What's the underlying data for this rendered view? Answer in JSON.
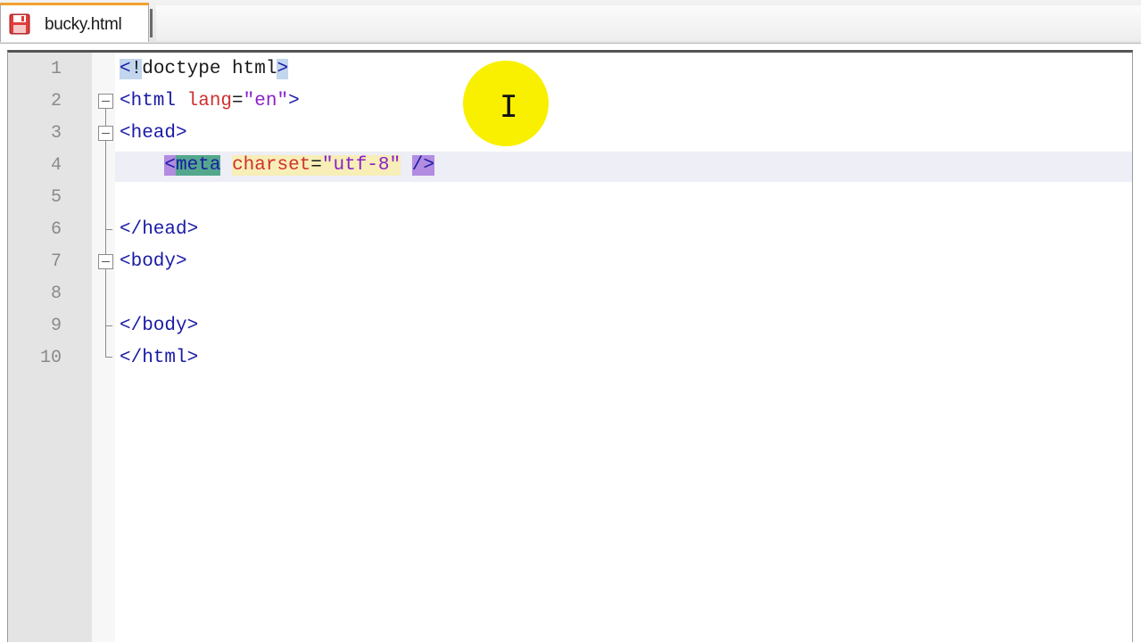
{
  "tab": {
    "filename": "bucky.html",
    "icon": "save-disk-icon"
  },
  "editor": {
    "line_numbers": [
      "1",
      "2",
      "3",
      "4",
      "5",
      "6",
      "7",
      "8",
      "9",
      "10"
    ],
    "current_line": 4,
    "cursor_icon": "text-cursor-icon",
    "lines": {
      "l1": {
        "open": "<",
        "bang": "!",
        "doctype": "doctype html",
        "close": ">"
      },
      "l2": {
        "tag": "<html",
        "attr": "lang",
        "eq": "=",
        "val": "\"en\"",
        "close": ">"
      },
      "l3": {
        "tag": "<head>"
      },
      "l4": {
        "lt": "<",
        "name": "meta",
        "attr": "charset",
        "eq": "=",
        "val": "\"utf-8\"",
        "end": "/>"
      },
      "l6": {
        "tag": "</head>"
      },
      "l7": {
        "tag": "<body>"
      },
      "l9": {
        "tag": "</body>"
      },
      "l10": {
        "tag": "</html>"
      }
    }
  },
  "colors": {
    "tag": "#1a1aa6",
    "attribute": "#d03030",
    "string": "#8a20c8",
    "gutter_bg": "#e4e4e4",
    "tab_accent": "#f0a030",
    "spotlight": "#f9f000"
  }
}
